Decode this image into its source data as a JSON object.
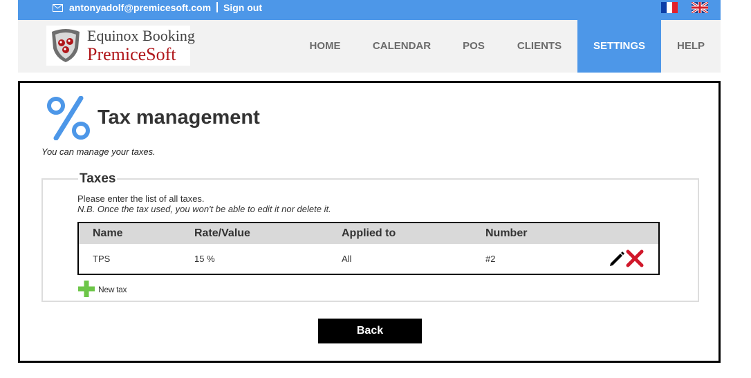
{
  "topbar": {
    "email": "antonyadolf@premicesoft.com",
    "signout": "Sign out",
    "icons": {
      "mail": "mail-icon",
      "flag_fr": "flag-fr-icon",
      "flag_uk": "flag-uk-icon"
    },
    "color": "#4d97e8"
  },
  "logo": {
    "line1": "Equinox Booking",
    "line2": "PremiceSoft"
  },
  "nav": {
    "items": [
      {
        "label": "HOME"
      },
      {
        "label": "CALENDAR"
      },
      {
        "label": "POS"
      },
      {
        "label": "CLIENTS"
      },
      {
        "label": "SETTINGS",
        "active": true
      },
      {
        "label": "HELP"
      }
    ],
    "active_color": "#4d97e8"
  },
  "page": {
    "title": "Tax management",
    "subtitle": "You can manage your taxes.",
    "icon": "percent-icon"
  },
  "taxes": {
    "legend": "Taxes",
    "info1": "Please enter the list of all taxes.",
    "info2": "N.B. Once the tax used, you won't be able to edit it nor delete it.",
    "headers": [
      "Name",
      "Rate/Value",
      "Applied to",
      "Number"
    ],
    "rows": [
      {
        "name": "TPS",
        "rate": "15 %",
        "applied": "All",
        "number": "#2"
      }
    ],
    "new_tax_label": "New tax"
  },
  "back_button": "Back"
}
